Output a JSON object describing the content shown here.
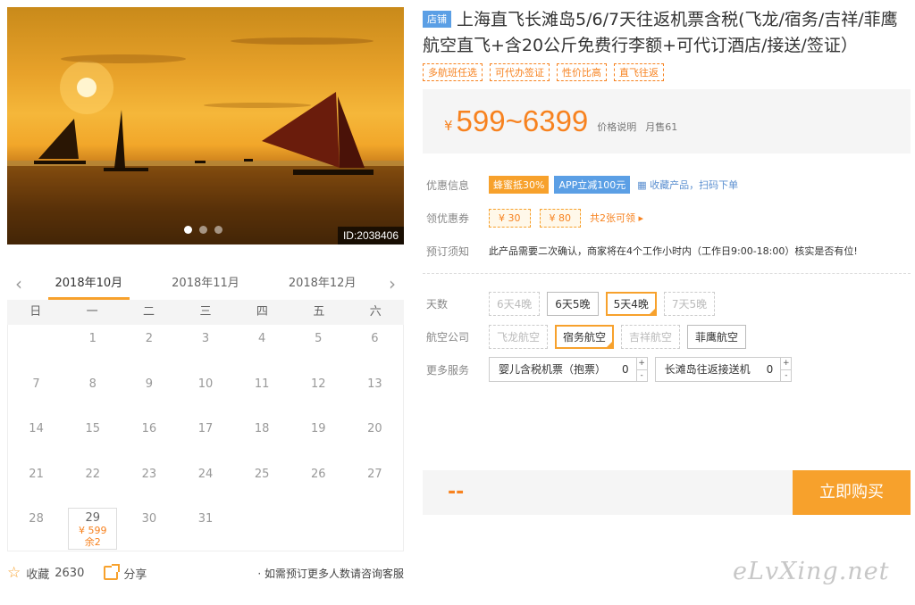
{
  "hero": {
    "image_id": "ID:2038406"
  },
  "calendar": {
    "prev_icon": "chevron-left-icon",
    "next_icon": "chevron-right-icon",
    "months": [
      "2018年10月",
      "2018年11月",
      "2018年12月"
    ],
    "weekdays": [
      "日",
      "一",
      "二",
      "三",
      "四",
      "五",
      "六"
    ],
    "days": [
      {
        "d": ""
      },
      {
        "d": "1"
      },
      {
        "d": "2"
      },
      {
        "d": "3"
      },
      {
        "d": "4"
      },
      {
        "d": "5"
      },
      {
        "d": "6"
      },
      {
        "d": "7"
      },
      {
        "d": "8"
      },
      {
        "d": "9"
      },
      {
        "d": "10"
      },
      {
        "d": "11"
      },
      {
        "d": "12"
      },
      {
        "d": "13"
      },
      {
        "d": "14"
      },
      {
        "d": "15"
      },
      {
        "d": "16"
      },
      {
        "d": "17"
      },
      {
        "d": "18"
      },
      {
        "d": "19"
      },
      {
        "d": "20"
      },
      {
        "d": "21"
      },
      {
        "d": "22"
      },
      {
        "d": "23"
      },
      {
        "d": "24"
      },
      {
        "d": "25"
      },
      {
        "d": "26"
      },
      {
        "d": "27"
      },
      {
        "d": "28"
      },
      {
        "d": "29",
        "price": "¥ 599",
        "stock": "余2"
      },
      {
        "d": "30"
      },
      {
        "d": "31"
      },
      {
        "d": ""
      },
      {
        "d": ""
      },
      {
        "d": ""
      }
    ]
  },
  "social": {
    "fav_label": "收藏",
    "fav_count": "2630",
    "share_label": "分享",
    "consult": "· 如需预订更多人数请咨询客服"
  },
  "product": {
    "shop_badge": "店铺",
    "title": "上海直飞长滩岛5/6/7天往返机票含税(飞龙/宿务/吉祥/菲鹰航空直飞+含20公斤免费行李额+可代订酒店/接送/签证）",
    "tags": [
      "多航班任选",
      "可代办签证",
      "性价比高",
      "直飞往返"
    ]
  },
  "price": {
    "yen": "¥",
    "amount": "599~6399",
    "note": "价格说明",
    "sold": "月售61"
  },
  "promo": {
    "label": "优惠信息",
    "badge1": "蜂蜜抵30%",
    "badge2": "APP立减100元",
    "qr_text": "收藏产品，扫码下单"
  },
  "coupons": {
    "label": "领优惠券",
    "items": [
      "¥ 30",
      "¥ 80"
    ],
    "more": "共2张可领 ▸"
  },
  "booking": {
    "label": "预订须知",
    "text": "此产品需要二次确认，商家将在4个工作小时内（工作日9:00-18:00）核实是否有位!"
  },
  "days": {
    "label": "天数",
    "options": [
      "6天4晚",
      "6天5晚",
      "5天4晚",
      "7天5晚"
    ]
  },
  "airline": {
    "label": "航空公司",
    "options": [
      "飞龙航空",
      "宿务航空",
      "吉祥航空",
      "菲鹰航空"
    ]
  },
  "services": {
    "label": "更多服务",
    "items": [
      {
        "name": "婴儿含税机票（抱票）",
        "qty": "0"
      },
      {
        "name": "长滩岛往返接送机",
        "qty": "0"
      }
    ],
    "plus": "+",
    "minus": "-"
  },
  "buy": {
    "placeholder": "--",
    "button": "立即购买"
  },
  "watermark": "eLvXing.net",
  "colors": {
    "accent": "#f7a12c",
    "price": "#f7821f",
    "link_blue": "#5b9fe5"
  }
}
